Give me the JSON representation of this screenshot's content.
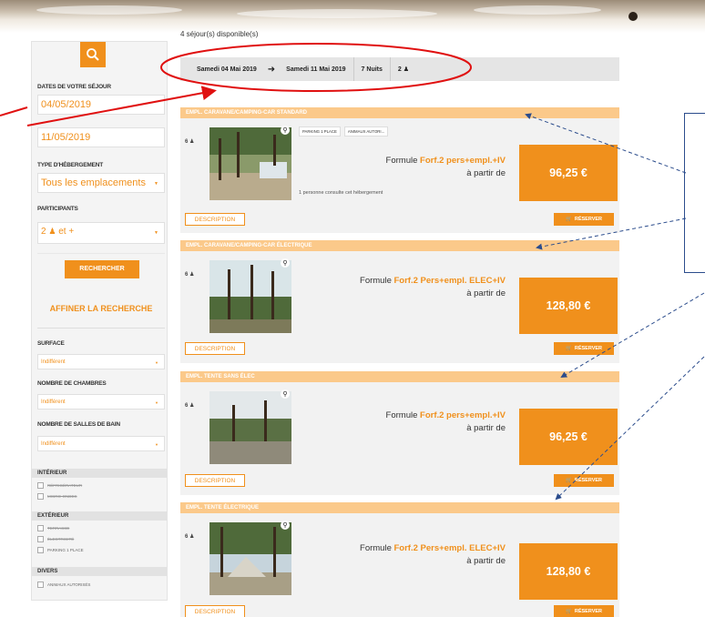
{
  "availability": "4 séjour(s) disponible(s)",
  "summary": {
    "start": "Samedi 04 Mai 2019",
    "end": "Samedi 11 Mai 2019",
    "nights": "7 Nuits",
    "guests": "2"
  },
  "sidebar": {
    "dates_label": "DATES DE VOTRE SÉJOUR",
    "date_from": "04/05/2019",
    "date_to": "11/05/2019",
    "type_label": "TYPE D'HÉBERGEMENT",
    "type_value": "Tous les emplacements",
    "participants_label": "PARTICIPANTS",
    "participants_value": "2",
    "participants_suffix": "et +",
    "search_button": "RECHERCHER",
    "refine_title": "AFFINER LA RECHERCHE",
    "surface_label": "SURFACE",
    "surface_value": "Indifférent",
    "rooms_label": "NOMBRE DE CHAMBRES",
    "rooms_value": "Indifférent",
    "baths_label": "NOMBRE DE SALLES DE BAIN",
    "baths_value": "Indifférent",
    "interior_label": "INTÉRIEUR",
    "interior_items": [
      "RÉFRIGÉRATEUR",
      "MICRO-ONDES"
    ],
    "exterior_label": "EXTÉRIEUR",
    "exterior_items": [
      "TERRASSE",
      "ÉLECTRICITÉ",
      "PARKING 1 PLACE"
    ],
    "other_label": "DIVERS",
    "other_items": [
      "ANIMAUX AUTORISÉS"
    ]
  },
  "cards": [
    {
      "title": "EMPL. CARAVANE/CAMPING-CAR STANDARD",
      "guests": "6",
      "tags": [
        "PARKING 1 PLACE",
        "ANIMAUX AUTORI..."
      ],
      "formula_prefix": "Formule",
      "formula_name": "Forf.2 pers+empl.+IV",
      "from_text": "à partir de",
      "price": "96,25 €",
      "consult": "1 personne consulte cet hébergement",
      "desc_button": "DESCRIPTION",
      "book_button": "RÉSERVER"
    },
    {
      "title": "EMPL. CARAVANE/CAMPING-CAR ÉLECTRIQUE",
      "guests": "6",
      "formula_prefix": "Formule",
      "formula_name": "Forf.2 Pers+empl. ELEC+IV",
      "from_text": "à partir de",
      "price": "128,80 €",
      "desc_button": "DESCRIPTION",
      "book_button": "RÉSERVER"
    },
    {
      "title": "EMPL. TENTE SANS ÉLEC",
      "guests": "6",
      "formula_prefix": "Formule",
      "formula_name": "Forf.2 pers+empl.+IV",
      "from_text": "à partir de",
      "price": "96,25 €",
      "desc_button": "DESCRIPTION",
      "book_button": "RÉSERVER"
    },
    {
      "title": "EMPL. TENTE ÉLECTRIQUE",
      "guests": "6",
      "formula_prefix": "Formule",
      "formula_name": "Forf.2 Pers+empl. ELEC+IV",
      "from_text": "à partir de",
      "price": "128,80 €",
      "desc_button": "DESCRIPTION",
      "book_button": "RÉSERVER"
    }
  ],
  "colors": {
    "accent": "#f0901c",
    "card_header": "#fbc98a",
    "annotation_red": "#e01010",
    "annotation_blue": "#2b4c8c"
  }
}
